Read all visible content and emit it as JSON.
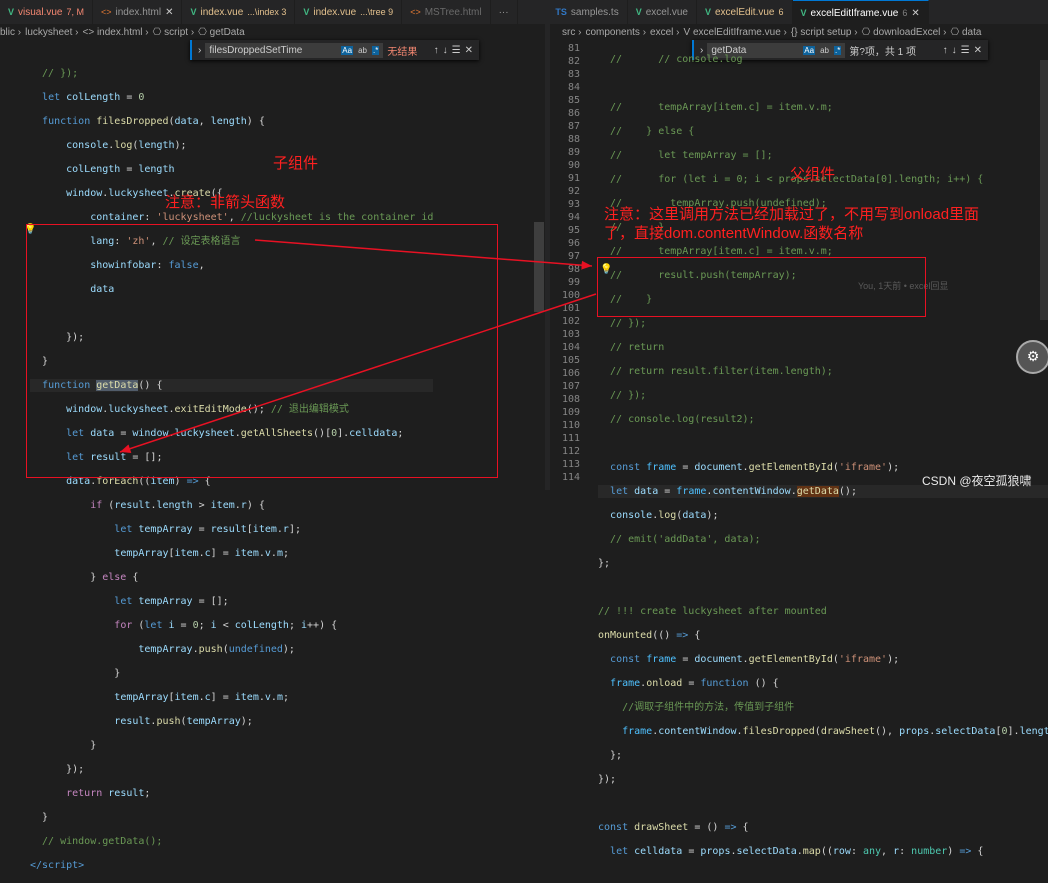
{
  "left_tabs": [
    {
      "icon": "V",
      "label": "visual.vue",
      "suffix": "7, M",
      "style": "err"
    },
    {
      "icon": "<>",
      "label": "index.html",
      "suffix": "",
      "style": "",
      "close": "✕"
    },
    {
      "icon": "V",
      "label": "index.vue",
      "suffix": "...\\index 3",
      "style": "modified"
    },
    {
      "icon": "V",
      "label": "index.vue",
      "suffix": "...\\tree 9",
      "style": "modified"
    },
    {
      "icon": "<>",
      "label": "MSTree.html",
      "suffix": "",
      "style": "dim"
    }
  ],
  "right_tabs": [
    {
      "icon": "TS",
      "label": "samples.ts",
      "suffix": "",
      "style": ""
    },
    {
      "icon": "V",
      "label": "excel.vue",
      "suffix": "",
      "style": ""
    },
    {
      "icon": "V",
      "label": "excelEdit.vue",
      "suffix": "6",
      "style": "modified"
    },
    {
      "icon": "V",
      "label": "excelEditIframe.vue",
      "suffix": "6",
      "style": "active",
      "close": "✕"
    }
  ],
  "left_more": "···",
  "left_breadcrumb": [
    "blic",
    "luckysheet",
    "<> index.html",
    "⎔ script",
    "⎔ getData"
  ],
  "right_breadcrumb": [
    "src",
    "components",
    "excel",
    "V excelEditIframe.vue",
    "{} script setup",
    "⎔ downloadExcel",
    "⎔ data"
  ],
  "left_find": {
    "query": "filesDroppedSetTime",
    "case": "Aa",
    "word": "ab",
    "regex": ".*",
    "result": "无结果"
  },
  "right_find": {
    "query": "getData",
    "case": "Aa",
    "word": "ab",
    "regex": ".*",
    "result": "第?项，共 1 项"
  },
  "left_gutter": [
    "",
    "",
    "",
    "",
    "",
    "",
    "",
    "",
    "",
    "",
    "",
    "",
    "",
    "",
    "",
    "",
    "",
    "",
    "",
    "",
    "",
    "",
    "",
    "",
    "",
    "",
    "",
    "",
    "",
    "",
    "",
    "",
    "",
    "",
    "",
    ""
  ],
  "right_gutter": [
    "81",
    "82",
    "83",
    "84",
    "85",
    "86",
    "87",
    "88",
    "89",
    "90",
    "91",
    "92",
    "93",
    "94",
    "95",
    "96",
    "97",
    "98",
    "99",
    "100",
    "101",
    "102",
    "103",
    "104",
    "105",
    "106",
    "107",
    "108",
    "109",
    "110",
    "111",
    "112",
    "113",
    "114"
  ],
  "annotations": {
    "child": "子组件",
    "parent": "父组件",
    "note_left": "注意：非箭头函数",
    "note_right_1": "注意：这里调用方法已经加载过了，不用写到onload里面",
    "note_right_2": "了，直接dom.contentWindow.函数名称"
  },
  "blame": "You, 1天前 • excel回显",
  "watermark": "CSDN @夜空孤狼啸"
}
